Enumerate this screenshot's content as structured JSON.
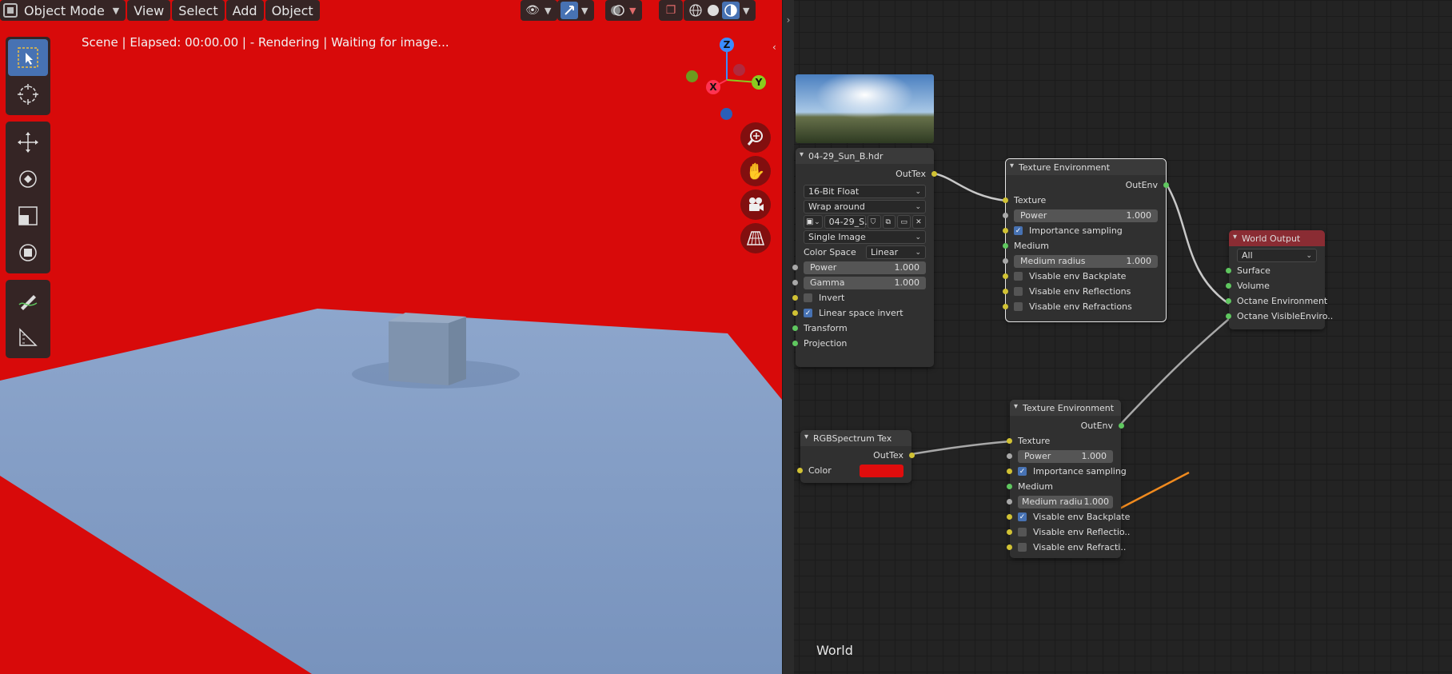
{
  "header": {
    "mode_label": "Object Mode",
    "menus": [
      "View",
      "Select",
      "Add",
      "Object"
    ]
  },
  "viewport": {
    "status_text": "Scene | Elapsed: 00:00.00 |  - Rendering | Waiting for image...",
    "background_color": "#d80a0a",
    "plane_color": "#8aa3c9",
    "axes": {
      "z": "Z",
      "x": "X",
      "y": "Y"
    },
    "tools": [
      "select-box-icon",
      "cursor-icon",
      "move-icon",
      "rotate-icon",
      "scale-icon",
      "transform-icon",
      "annotate-icon",
      "measure-icon"
    ],
    "nav_icons": [
      "zoom-icon",
      "pan-hand-icon",
      "camera-icon",
      "perspective-grid-icon"
    ]
  },
  "node_editor": {
    "editor_label": "World",
    "image_node": {
      "title": "04-29_Sun_B.hdr",
      "output": "OutTex",
      "bit_depth": "16-Bit Float",
      "wrap": "Wrap around",
      "image_name": "04-29_S..",
      "source": "Single Image",
      "color_space_label": "Color Space",
      "color_space_value": "Linear",
      "power_label": "Power",
      "power_value": "1.000",
      "gamma_label": "Gamma",
      "gamma_value": "1.000",
      "invert_label": "Invert",
      "linear_invert_label": "Linear space invert",
      "transform_label": "Transform",
      "projection_label": "Projection"
    },
    "tex_env_1": {
      "title": "Texture Environment",
      "output": "OutEnv",
      "texture": "Texture",
      "power_label": "Power",
      "power_value": "1.000",
      "importance": "Importance sampling",
      "medium": "Medium",
      "medium_radius_label": "Medium radius",
      "medium_radius_value": "1.000",
      "backplate": "Visable env Backplate",
      "reflections": "Visable env Reflections",
      "refractions": "Visable env Refractions"
    },
    "world_output": {
      "title": "World Output",
      "target": "All",
      "surface": "Surface",
      "volume": "Volume",
      "octane_env": "Octane Environment",
      "octane_visible": "Octane VisibleEnviro.."
    },
    "rgb_node": {
      "title": "RGBSpectrum Tex",
      "output": "OutTex",
      "color_label": "Color",
      "color_value": "#e00d0d"
    },
    "tex_env_2": {
      "title": "Texture Environment",
      "output": "OutEnv",
      "texture": "Texture",
      "power_label": "Power",
      "power_value": "1.000",
      "importance": "Importance sampling",
      "medium": "Medium",
      "medium_radius_label": "Medium radiu",
      "medium_radius_value": "1.000",
      "backplate": "Visable env Backplate",
      "reflections": "Visable env Reflectio..",
      "refractions": "Visable env Refracti.."
    },
    "annotation_arrow_color": "#f08a1e"
  }
}
